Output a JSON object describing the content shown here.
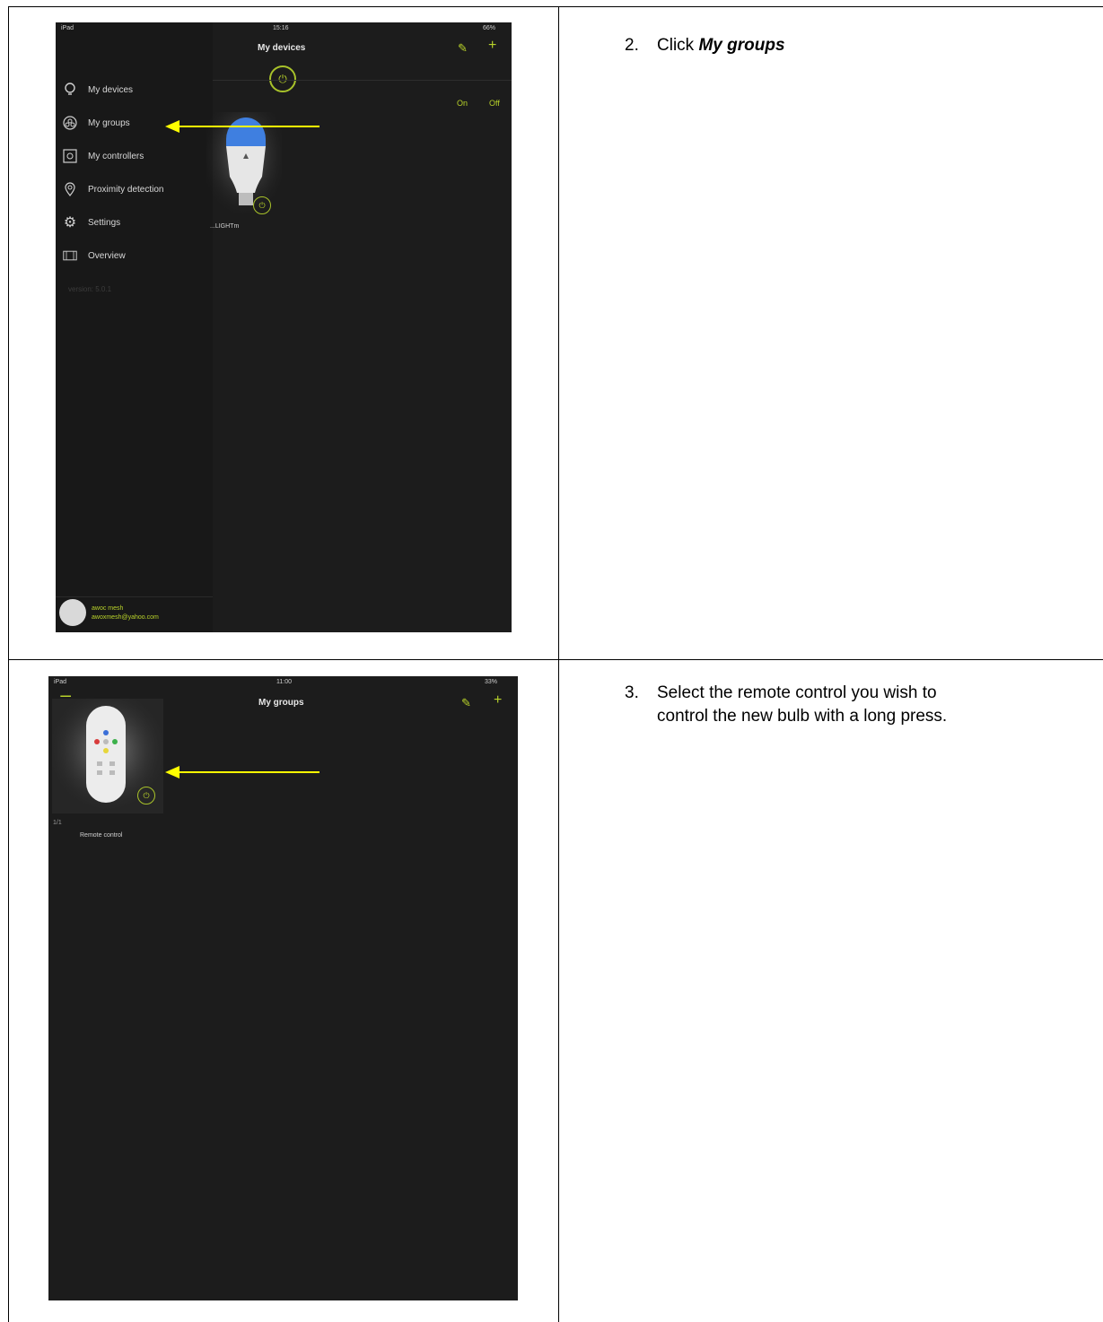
{
  "step2": {
    "number": "2.",
    "text_prefix": "Click ",
    "text_emphasis": "My groups"
  },
  "step3": {
    "number": "3.",
    "line1": "Select the remote control you wish to",
    "line2": "control the new bulb with a long press."
  },
  "screen1": {
    "status_left": "iPad",
    "status_time": "15:16",
    "status_right": "66%",
    "title": "My devices",
    "on_label": "On",
    "off_label": "Off",
    "menu": [
      {
        "label": "My devices",
        "icon": "bulb-outline-icon"
      },
      {
        "label": "My groups",
        "icon": "groups-icon"
      },
      {
        "label": "My controllers",
        "icon": "controller-icon"
      },
      {
        "label": "Proximity detection",
        "icon": "location-pin-icon"
      },
      {
        "label": "Settings",
        "icon": "gear-icon"
      },
      {
        "label": "Overview",
        "icon": "overview-icon"
      }
    ],
    "version": "version: 5.0.1",
    "device_label": "...LIGHTm",
    "user_name": "awoc mesh",
    "user_email": "awoxmesh@yahoo.com",
    "accent_color": "#b8d22a",
    "arrow_color": "#ffff00"
  },
  "screen2": {
    "status_left": "iPad",
    "status_time": "11:00",
    "status_right": "33%",
    "title": "My groups",
    "count": "1/1",
    "tile_label": "Remote control"
  }
}
